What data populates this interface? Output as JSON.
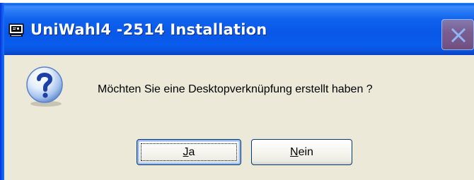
{
  "window": {
    "title": "UniWahl4 -2514 Installation",
    "app_icon": "computer-window-icon",
    "close_icon": "close-icon",
    "colors": {
      "title_bar": "#0A5AE8",
      "dialog_bg": "#ECE9D8",
      "close_button": "#D86448"
    }
  },
  "dialog": {
    "icon": "question-icon",
    "message": "Möchten Sie eine Desktopverknüpfung erstellt haben ?"
  },
  "buttons": {
    "yes": {
      "label": "Ja",
      "mnemonic": "J",
      "rest": "a"
    },
    "no": {
      "label": "Nein",
      "mnemonic": "N",
      "rest": "ein"
    }
  }
}
